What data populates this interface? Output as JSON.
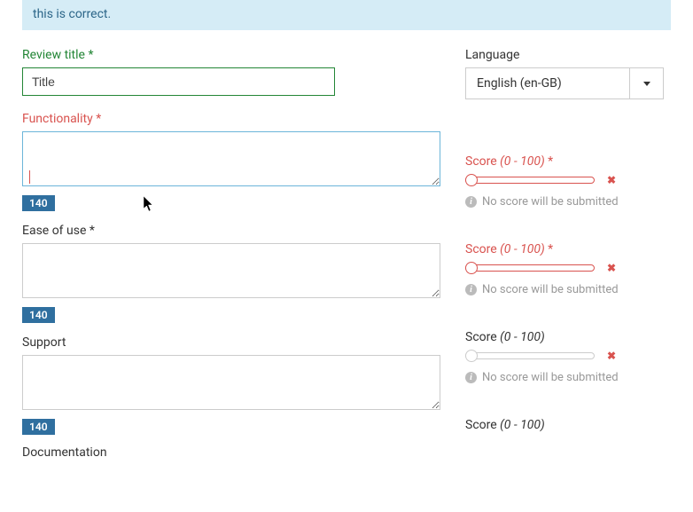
{
  "banner": {
    "text": "this is correct."
  },
  "left": {
    "title": {
      "label": "Review title",
      "value": "Title"
    },
    "functionality": {
      "label": "Functionality",
      "value": "",
      "count": "140"
    },
    "ease": {
      "label": "Ease of use",
      "value": "",
      "count": "140"
    },
    "support": {
      "label": "Support",
      "value": "",
      "count": "140"
    },
    "documentation": {
      "label": "Documentation"
    }
  },
  "right": {
    "language": {
      "label": "Language",
      "value": "English (en-GB)"
    },
    "scoreLabel": "Score",
    "scoreRange": "(0 - 100)",
    "hint": "No score will be submitted"
  },
  "asterisk": "*"
}
